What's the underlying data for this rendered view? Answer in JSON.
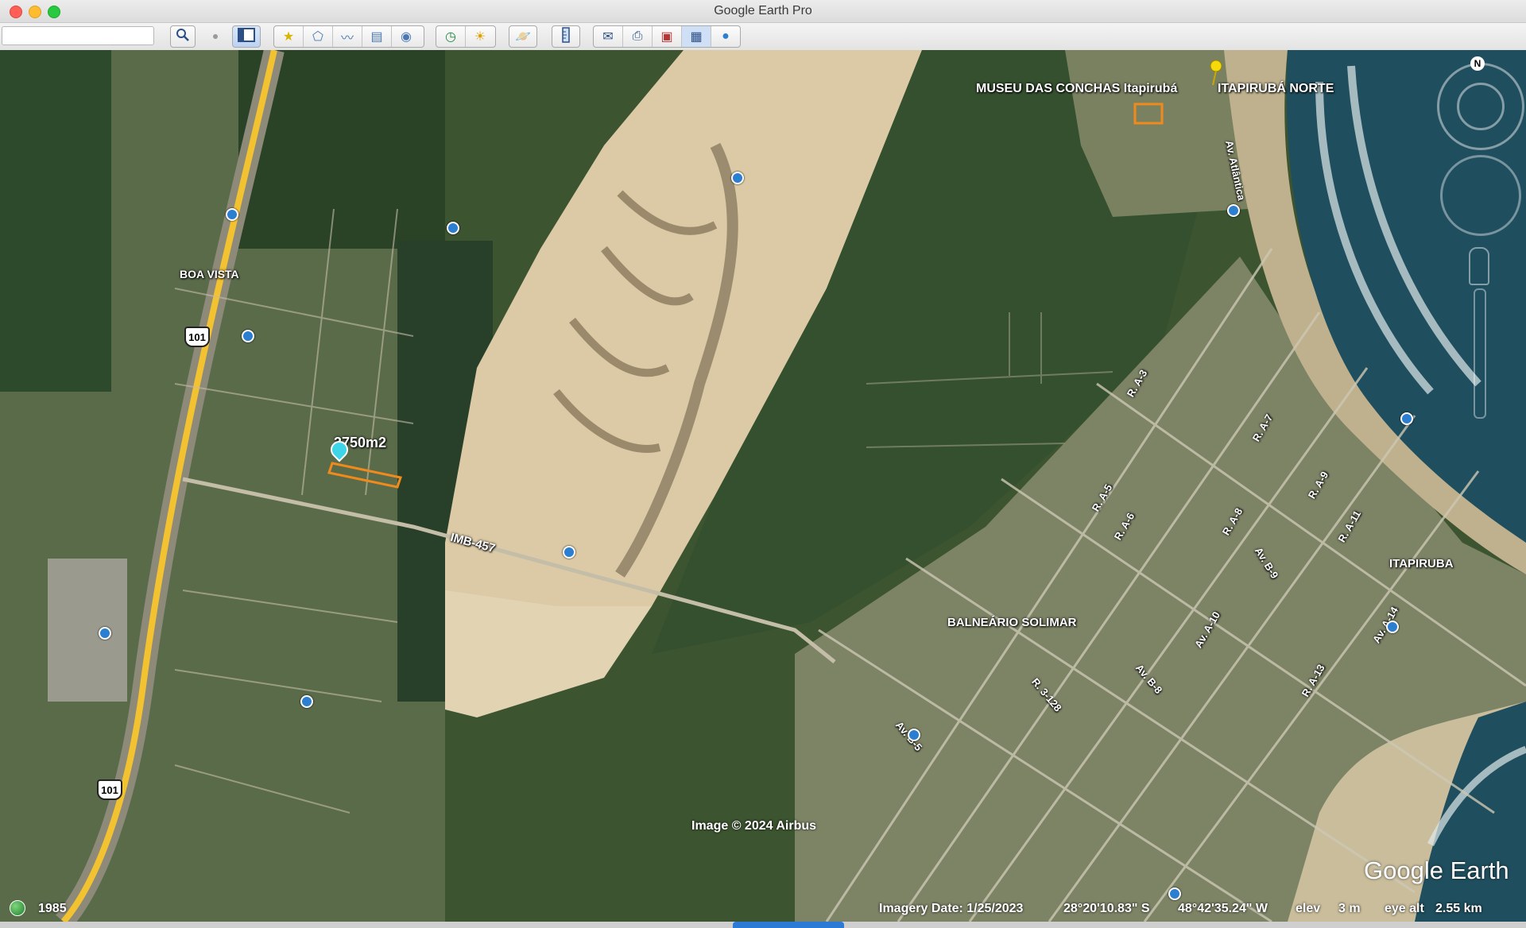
{
  "window": {
    "title": "Google Earth Pro"
  },
  "toolbar": {
    "search_value": "",
    "buttons": [
      "search-icon",
      "sidebar-toggle-icon",
      "placemark-icon",
      "polygon-icon",
      "path-icon",
      "image-overlay-icon",
      "record-tour-icon",
      "historical-imagery-icon",
      "sunlight-icon",
      "planets-icon",
      "ruler-icon",
      "email-icon",
      "print-icon",
      "save-image-icon",
      "view-in-maps-icon",
      "google-earth-globe-icon"
    ]
  },
  "map": {
    "labels": {
      "museu": "MUSEU DAS CONCHAS Itapirubá",
      "itapiruba_norte": "ITAPIRUBÁ NORTE",
      "boa_vista": "BOA VISTA",
      "parcel": "3750m2",
      "imb457": "IMB-457",
      "balneario": "BALNEÁRIO SOLIMAR",
      "itapiruba": "ITAPIRUBA",
      "av_atlantica": "Av. Atlântica",
      "ra3": "R. A-3",
      "ra5": "R. A-5",
      "ra6": "R. A-6",
      "ra7": "R. A-7",
      "ra8": "R. A-8",
      "ra9": "R. A-9",
      "ra11": "R. A-11",
      "avb9": "Av. B-9",
      "ava10": "Av. A-10",
      "ra13": "R. A-13",
      "ava14": "Av. A-14",
      "avb8": "Av. B-8",
      "r3128": "R. 3-128",
      "avb5": "Av. B-5"
    },
    "shields": {
      "upper": "101",
      "lower": "101"
    },
    "copyright": "Image © 2024 Airbus",
    "logo": "Google Earth",
    "compass_north": "N"
  },
  "status": {
    "historical_year": "1985",
    "imagery_date": "Imagery Date: 1/25/2023",
    "latitude": "28°20'10.83\" S",
    "longitude": "48°42'35.24\" W",
    "elev_label": "elev",
    "elev_value": "3 m",
    "eye_alt_label": "eye alt",
    "eye_alt_value": "2.55 km"
  },
  "colors": {
    "parcel_outline": "#f08a1c",
    "highway": "#f2c230",
    "poi": "#2c7fd0",
    "pin": "#3fd5e8"
  }
}
